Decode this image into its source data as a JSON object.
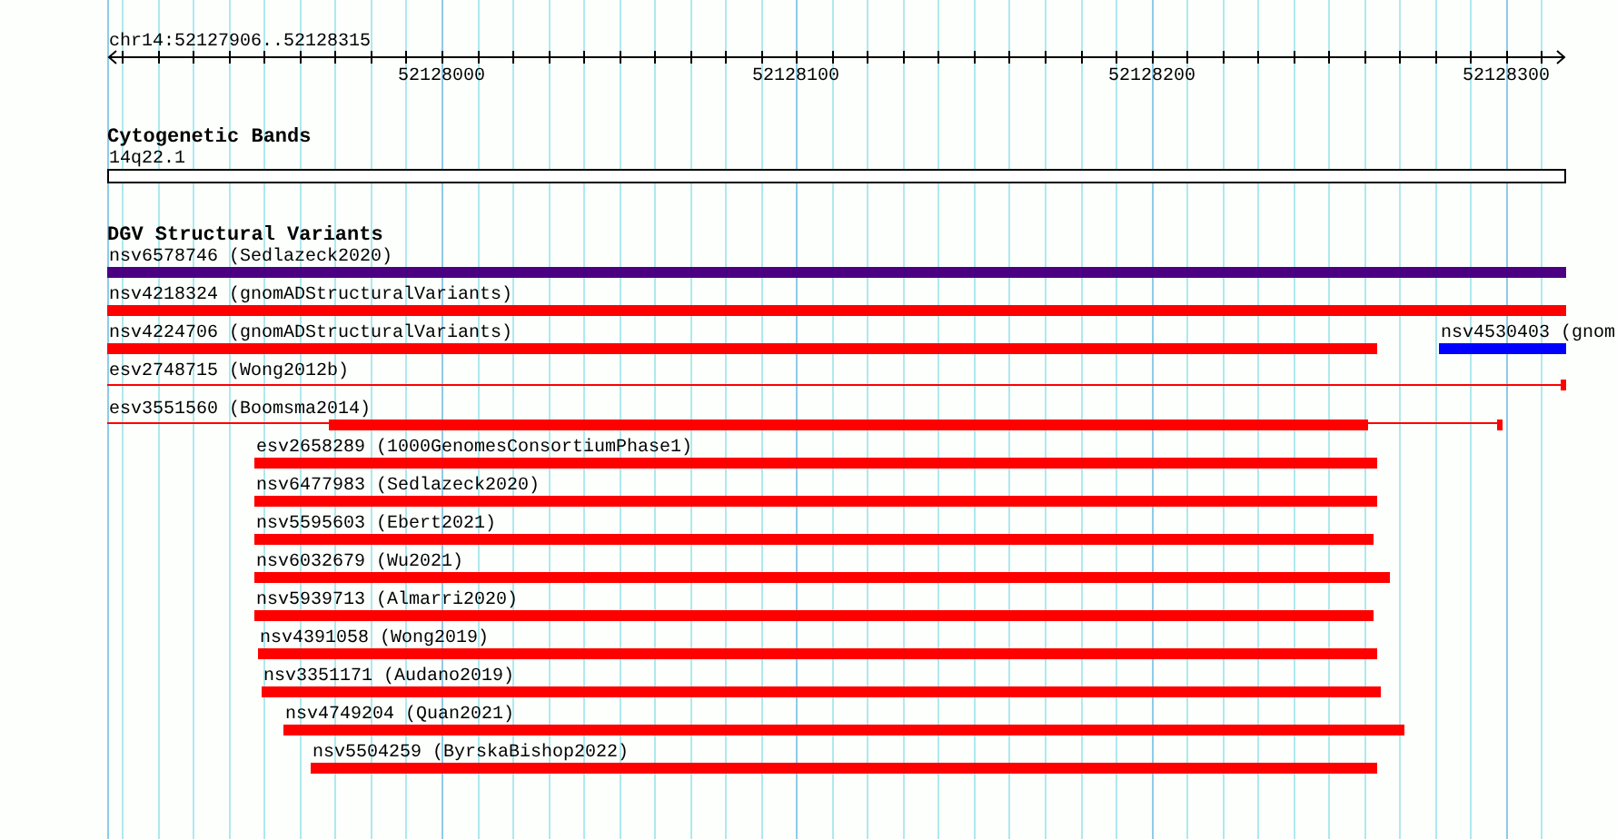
{
  "ruler": {
    "location": "chr14:52127906..52128315",
    "ticks": [
      "52128000",
      "52128100",
      "52128200",
      "52128300"
    ]
  },
  "tracks": [
    {
      "title": "Cytogenetic Bands",
      "features": [
        {
          "label": "14q22.1",
          "kind": "band"
        }
      ]
    },
    {
      "title": "DGV Structural Variants",
      "features": [
        {
          "label": "nsv6578746 (Sedlazeck2020)",
          "kind": "bar",
          "color": "#4b0082"
        },
        {
          "label": "nsv4218324 (gnomADStructuralVariants)",
          "kind": "bar",
          "color": "#ff0000"
        },
        {
          "label": "nsv4224706 (gnomADStructuralVariants)",
          "kind": "bar",
          "color": "#ff0000"
        },
        {
          "label": "nsv4530403 (gnom",
          "kind": "bar",
          "color": "#0000ff"
        },
        {
          "label": "esv2748715 (Wong2012b)",
          "kind": "line",
          "color": "#ff0000"
        },
        {
          "label": "esv3551560 (Boomsma2014)",
          "kind": "partial",
          "color": "#ff0000"
        },
        {
          "label": "esv2658289 (1000GenomesConsortiumPhase1)",
          "kind": "bar",
          "color": "#ff0000"
        },
        {
          "label": "nsv6477983 (Sedlazeck2020)",
          "kind": "bar",
          "color": "#ff0000"
        },
        {
          "label": "nsv5595603 (Ebert2021)",
          "kind": "bar",
          "color": "#ff0000"
        },
        {
          "label": "nsv6032679 (Wu2021)",
          "kind": "bar",
          "color": "#ff0000"
        },
        {
          "label": "nsv5939713 (Almarri2020)",
          "kind": "bar",
          "color": "#ff0000"
        },
        {
          "label": "nsv4391058 (Wong2019)",
          "kind": "bar",
          "color": "#ff0000"
        },
        {
          "label": "nsv3351171 (Audano2019)",
          "kind": "bar",
          "color": "#ff0000"
        },
        {
          "label": "nsv4749204 (Quan2021)",
          "kind": "bar",
          "color": "#ff0000"
        },
        {
          "label": "nsv5504259 (ByrskaBishop2022)",
          "kind": "bar",
          "color": "#ff0000"
        }
      ]
    }
  ]
}
